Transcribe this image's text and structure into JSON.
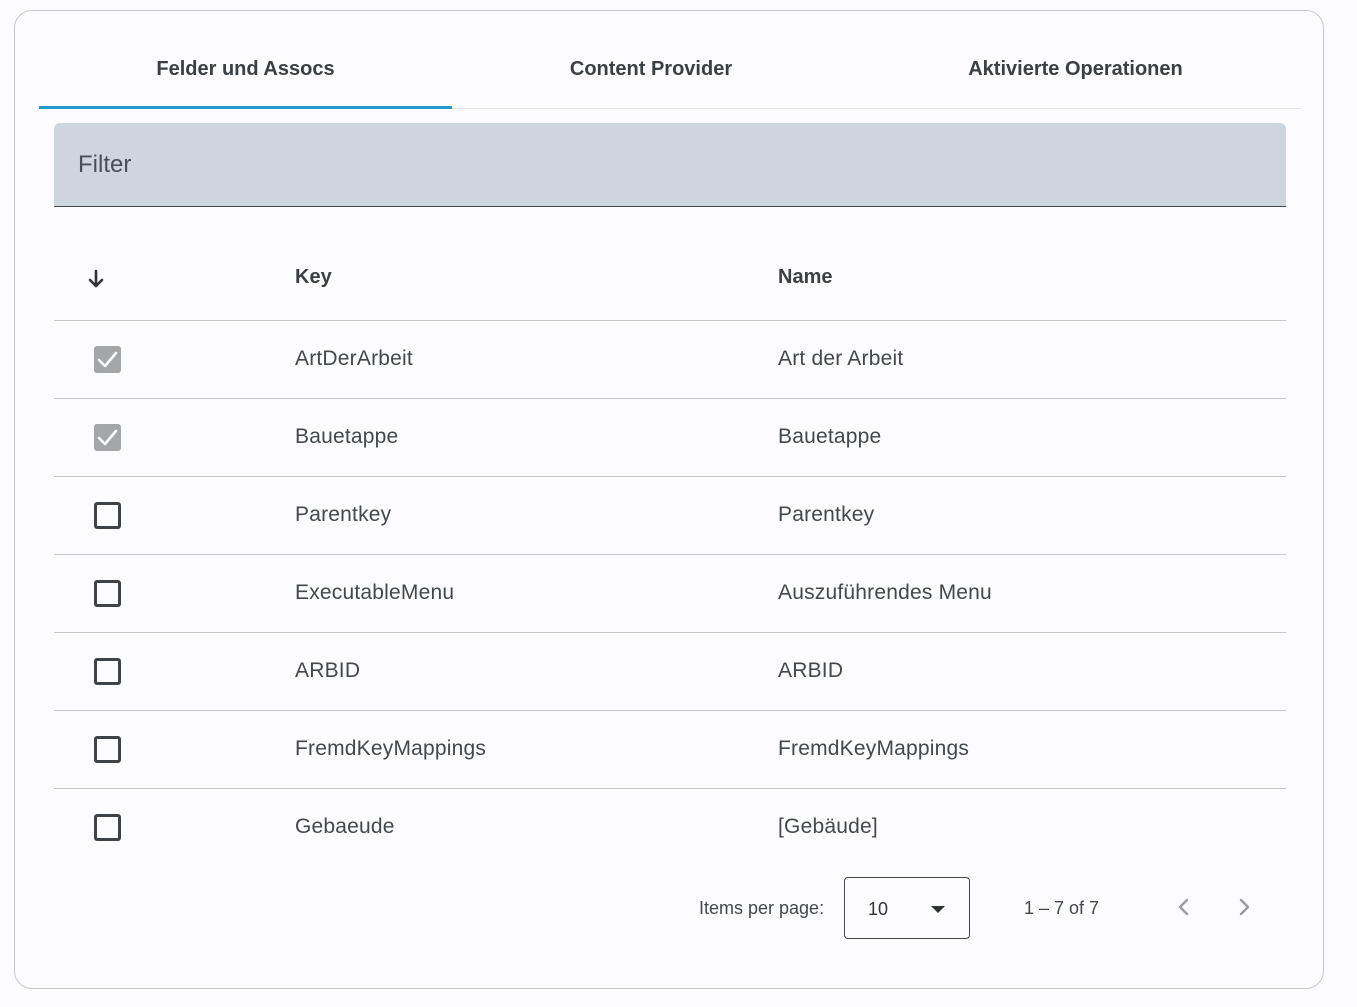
{
  "tabs": [
    {
      "label": "Felder und Assocs",
      "active": true
    },
    {
      "label": "Content Provider",
      "active": false
    },
    {
      "label": "Aktivierte Operationen",
      "active": false
    }
  ],
  "filter": {
    "placeholder": "Filter",
    "value": ""
  },
  "table": {
    "sort_icon": "arrow-down-icon",
    "headers": {
      "key": "Key",
      "name": "Name"
    },
    "rows": [
      {
        "checked": true,
        "key": "ArtDerArbeit",
        "name": "Art der Arbeit"
      },
      {
        "checked": true,
        "key": "Bauetappe",
        "name": "Bauetappe"
      },
      {
        "checked": false,
        "key": "Parentkey",
        "name": "Parentkey"
      },
      {
        "checked": false,
        "key": "ExecutableMenu",
        "name": "Auszuführendes Menu"
      },
      {
        "checked": false,
        "key": "ARBID",
        "name": "ARBID"
      },
      {
        "checked": false,
        "key": "FremdKeyMappings",
        "name": "FremdKeyMappings"
      },
      {
        "checked": false,
        "key": "Gebaeude",
        "name": "[Gebäude]"
      }
    ]
  },
  "paginator": {
    "items_per_page_label": "Items per page:",
    "items_per_page_value": "10",
    "range_label": "1 – 7 of 7"
  },
  "colors": {
    "accent": "#1f9bcf",
    "filter_bg": "#cdd5df",
    "checked_bg": "#a4a6aa"
  }
}
